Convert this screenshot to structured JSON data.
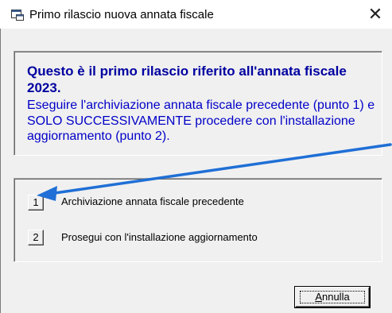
{
  "window": {
    "title": "Primo rilascio nuova annata fiscale",
    "close_glyph": "✕"
  },
  "info": {
    "bold_text": "Questo è il primo rilascio riferito all'annata fiscale 2023.",
    "body_text": "Eseguire  l'archiviazione annata fiscale precedente (punto 1) e SOLO SUCCESSIVAMENTE procedere con l'installazione aggiornamento (punto 2)."
  },
  "options": [
    {
      "number": "1",
      "label": "Archiviazione annata fiscale precedente"
    },
    {
      "number": "2",
      "label": "Prosegui con l'installazione aggiornamento"
    }
  ],
  "buttons": {
    "cancel_first_letter": "A",
    "cancel_rest": "nnulla"
  },
  "colors": {
    "info_bold": "#0000a0",
    "info_text": "#0000c8",
    "annotation_arrow": "#1f6fd6"
  },
  "icons": {
    "title_icon": "app-window-icon",
    "close": "close-icon",
    "annotation": "annotation-arrow"
  }
}
